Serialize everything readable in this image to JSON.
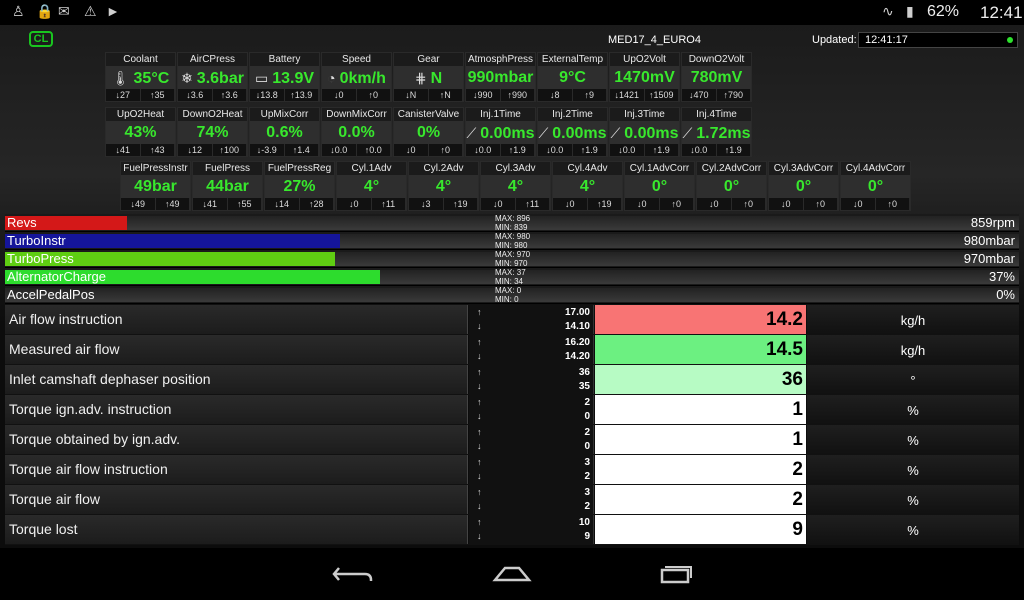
{
  "status": {
    "battery": "62%",
    "time": "12:41"
  },
  "header": {
    "cl": "CL",
    "ecu": "MED17_4_EURO4",
    "updated_label": "Updated:",
    "updated_time": "12:41:17"
  },
  "gauges_row1": [
    {
      "title": "Coolant",
      "value": "35°C",
      "icon": "thermometer-icon",
      "min": "↓27",
      "max": "↑35"
    },
    {
      "title": "AirCPress",
      "value": "3.6bar",
      "icon": "snowflake-icon",
      "min": "↓3.6",
      "max": "↑3.6"
    },
    {
      "title": "Battery",
      "value": "13.9V",
      "icon": "battery-icon",
      "min": "↓13.8",
      "max": "↑13.9"
    },
    {
      "title": "Speed",
      "value": "0km/h",
      "icon": "speedometer-icon",
      "min": "↓0",
      "max": "↑0"
    },
    {
      "title": "Gear",
      "value": "N",
      "icon": "gear-shift-icon",
      "min": "↓N",
      "max": "↑N"
    },
    {
      "title": "AtmosphPress",
      "value": "990mbar",
      "icon": "",
      "min": "↓990",
      "max": "↑990"
    },
    {
      "title": "ExternalTemp",
      "value": "9°C",
      "icon": "",
      "min": "↓8",
      "max": "↑9"
    },
    {
      "title": "UpO2Volt",
      "value": "1470mV",
      "icon": "",
      "min": "↓1421",
      "max": "↑1509"
    },
    {
      "title": "DownO2Volt",
      "value": "780mV",
      "icon": "",
      "min": "↓470",
      "max": "↑790"
    }
  ],
  "gauges_row2": [
    {
      "title": "UpO2Heat",
      "value": "43%",
      "icon": "",
      "min": "↓41",
      "max": "↑43"
    },
    {
      "title": "DownO2Heat",
      "value": "74%",
      "icon": "",
      "min": "↓12",
      "max": "↑100"
    },
    {
      "title": "UpMixCorr",
      "value": "0.6%",
      "icon": "",
      "min": "↓-3.9",
      "max": "↑1.4"
    },
    {
      "title": "DownMixCorr",
      "value": "0.0%",
      "icon": "",
      "min": "↓0.0",
      "max": "↑0.0"
    },
    {
      "title": "CanisterValve",
      "value": "0%",
      "icon": "",
      "min": "↓0",
      "max": "↑0"
    },
    {
      "title": "Inj.1Time",
      "value": "0.00ms",
      "icon": "injector-icon",
      "min": "↓0.0",
      "max": "↑1.9"
    },
    {
      "title": "Inj.2Time",
      "value": "0.00ms",
      "icon": "injector-icon",
      "min": "↓0.0",
      "max": "↑1.9"
    },
    {
      "title": "Inj.3Time",
      "value": "0.00ms",
      "icon": "injector-icon",
      "min": "↓0.0",
      "max": "↑1.9"
    },
    {
      "title": "Inj.4Time",
      "value": "1.72ms",
      "icon": "injector-icon",
      "min": "↓0.0",
      "max": "↑1.9"
    }
  ],
  "gauges_row3": [
    {
      "title": "FuelPressInstr",
      "value": "49bar",
      "icon": "",
      "min": "↓49",
      "max": "↑49"
    },
    {
      "title": "FuelPress",
      "value": "44bar",
      "icon": "",
      "min": "↓41",
      "max": "↑55"
    },
    {
      "title": "FuelPressReg",
      "value": "27%",
      "icon": "",
      "min": "↓14",
      "max": "↑28"
    },
    {
      "title": "Cyl.1Adv",
      "value": "4°",
      "icon": "",
      "min": "↓0",
      "max": "↑11"
    },
    {
      "title": "Cyl.2Adv",
      "value": "4°",
      "icon": "",
      "min": "↓3",
      "max": "↑19"
    },
    {
      "title": "Cyl.3Adv",
      "value": "4°",
      "icon": "",
      "min": "↓0",
      "max": "↑11"
    },
    {
      "title": "Cyl.4Adv",
      "value": "4°",
      "icon": "",
      "min": "↓0",
      "max": "↑19"
    },
    {
      "title": "Cyl.1AdvCorr",
      "value": "0°",
      "icon": "",
      "min": "↓0",
      "max": "↑0"
    },
    {
      "title": "Cyl.2AdvCorr",
      "value": "0°",
      "icon": "",
      "min": "↓0",
      "max": "↑0"
    },
    {
      "title": "Cyl.3AdvCorr",
      "value": "0°",
      "icon": "",
      "min": "↓0",
      "max": "↑0"
    },
    {
      "title": "Cyl.4AdvCorr",
      "value": "0°",
      "icon": "",
      "min": "↓0",
      "max": "↑0"
    }
  ],
  "bars": [
    {
      "name": "Revs",
      "value": "859rpm",
      "maxtxt": "MAX: 896",
      "mintxt": "MIN: 839",
      "level": 0.12,
      "color": "#d41818"
    },
    {
      "name": "TurboInstr",
      "value": "980mbar",
      "maxtxt": "MAX: 980",
      "mintxt": "MIN: 980",
      "level": 0.33,
      "color": "#15159a"
    },
    {
      "name": "TurboPress",
      "value": "970mbar",
      "maxtxt": "MAX: 970",
      "mintxt": "MIN: 970",
      "level": 0.325,
      "color": "#5fce12"
    },
    {
      "name": "AlternatorCharge",
      "value": "37%",
      "maxtxt": "MAX: 37",
      "mintxt": "MIN: 34",
      "level": 0.37,
      "color": "#2ddc2d"
    },
    {
      "name": "AccelPedalPos",
      "value": "0%",
      "maxtxt": "MAX: 0",
      "mintxt": "MIN: 0",
      "level": 0.0,
      "color": "#888888"
    }
  ],
  "table": [
    {
      "label": "Air flow instruction",
      "max": "17.00",
      "min": "14.10",
      "value": "14.2",
      "unit": "kg/h",
      "bg": "#f87474"
    },
    {
      "label": "Measured air flow",
      "max": "16.20",
      "min": "14.20",
      "value": "14.5",
      "unit": "kg/h",
      "bg": "#6cf081"
    },
    {
      "label": "Inlet camshaft dephaser position",
      "max": "36",
      "min": "35",
      "value": "36",
      "unit": "°",
      "bg": "#b7fbc4"
    },
    {
      "label": "Torque ign.adv. instruction",
      "max": "2",
      "min": "0",
      "value": "1",
      "unit": "%",
      "bg": "#ffffff"
    },
    {
      "label": "Torque obtained by ign.adv.",
      "max": "2",
      "min": "0",
      "value": "1",
      "unit": "%",
      "bg": "#ffffff"
    },
    {
      "label": "Torque air flow instruction",
      "max": "3",
      "min": "2",
      "value": "2",
      "unit": "%",
      "bg": "#ffffff"
    },
    {
      "label": "Torque air flow",
      "max": "3",
      "min": "2",
      "value": "2",
      "unit": "%",
      "bg": "#ffffff"
    },
    {
      "label": "Torque lost",
      "max": "10",
      "min": "9",
      "value": "9",
      "unit": "%",
      "bg": "#ffffff"
    }
  ],
  "navbar": {
    "back": "back-icon",
    "home": "home-icon",
    "recents": "recents-icon"
  }
}
